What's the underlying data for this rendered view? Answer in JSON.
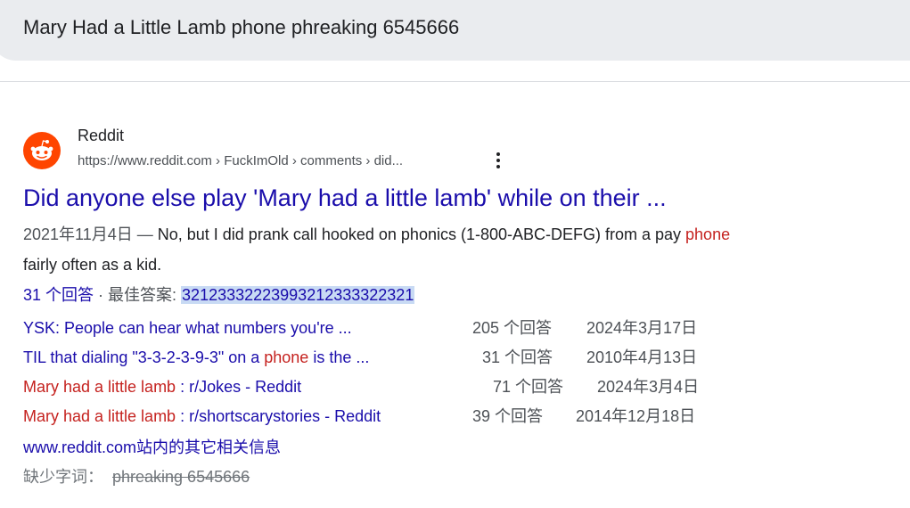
{
  "search": {
    "query": "Mary Had a Little Lamb phone phreaking 6545666"
  },
  "result": {
    "favicon_icon": "reddit-alien-icon",
    "site_name": "Reddit",
    "url": "https://www.reddit.com › FuckImOld › comments › did...",
    "more_icon": "kebab-menu-icon",
    "title": "Did anyone else play 'Mary had a little lamb' while on their ...",
    "snippet": {
      "date": "2021年11月4日 — ",
      "text_before": "No, but I did prank call hooked on phonics (1-800-ABC-DEFG) from a pay ",
      "highlight": "phone",
      "text_after": "fairly often as a kid."
    },
    "answers": {
      "count": "31 个回答",
      "separator": " · ",
      "best_label": "最佳答案: ",
      "best_value": "32123332223993212333322321"
    },
    "related": [
      {
        "title": "YSK: People can hear what numbers you're ...",
        "red": "",
        "suffix": "",
        "count": "205 个回答",
        "date": "2024年3月17日"
      },
      {
        "title": "TIL that dialing \"3-3-2-3-9-3\" on a ",
        "red": "phone",
        "suffix": " is the ...",
        "count": "31 个回答",
        "date": "2010年4月13日"
      },
      {
        "title": "",
        "red": "Mary had a little lamb",
        "suffix": " : r/Jokes - Reddit",
        "count": "71 个回答",
        "date": "2024年3月4日"
      },
      {
        "title": "",
        "red": "Mary had a little lamb",
        "suffix": " : r/shortscarystories - Reddit",
        "count": "39 个回答",
        "date": "2014年12月18日"
      }
    ],
    "more_link": "www.reddit.com站内的其它相关信息",
    "missing_label": "缺少字词：",
    "missing_terms": "phreaking 6545666"
  },
  "colors": {
    "link": "#1a0dab",
    "highlight_red": "#c5221f",
    "reddit_orange": "#ff4500",
    "selection": "#c8daf4"
  }
}
